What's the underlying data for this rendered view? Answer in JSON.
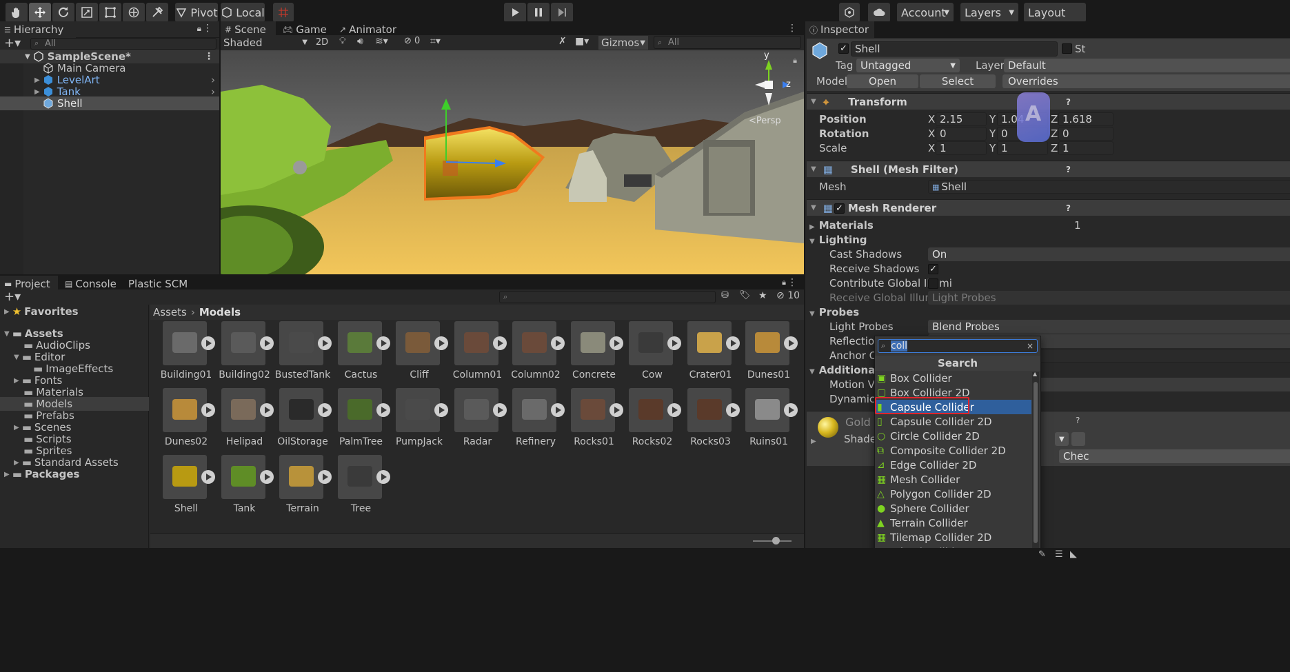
{
  "toolbar": {
    "pivot": "Pivot",
    "local": "Local",
    "account": "Account",
    "layers": "Layers",
    "layout": "Layout"
  },
  "hierarchy": {
    "tab": "Hierarchy",
    "search_placeholder": "All",
    "scene": "SampleScene*",
    "items": [
      "Main Camera",
      "LevelArt",
      "Tank",
      "Shell"
    ]
  },
  "scene_view": {
    "tabs": [
      "Scene",
      "Game",
      "Animator"
    ],
    "shading": "Shaded",
    "mode2d": "2D",
    "hidden_count": "0",
    "gizmos": "Gizmos",
    "search_placeholder": "All",
    "persp": "<Persp",
    "axis_y": "y",
    "axis_z": "z"
  },
  "project": {
    "tabs": [
      "Project",
      "Console",
      "Plastic SCM"
    ],
    "hidden_count": "10",
    "favorites": "Favorites",
    "assets_root": "Assets",
    "folders": [
      "AudioClips",
      "Editor",
      "ImageEffects",
      "Fonts",
      "Materials",
      "Models",
      "Prefabs",
      "Scenes",
      "Scripts",
      "Sprites",
      "Standard Assets"
    ],
    "packages": "Packages",
    "breadcrumb": [
      "Assets",
      "Models"
    ],
    "assets": [
      "Building01",
      "Building02",
      "BustedTank",
      "Cactus",
      "Cliff",
      "Column01",
      "Column02",
      "Concrete",
      "Cow",
      "Crater01",
      "Dunes01",
      "Dunes02",
      "Helipad",
      "OilStorage",
      "PalmTree",
      "PumpJack",
      "Radar",
      "Refinery",
      "Rocks01",
      "Rocks02",
      "Rocks03",
      "Ruins01",
      "Shell",
      "Tank",
      "Terrain",
      "Tree"
    ]
  },
  "inspector": {
    "tab": "Inspector",
    "object_name": "Shell",
    "static_partial": "St",
    "tag_label": "Tag",
    "tag_value": "Untagged",
    "layer_label": "Layer",
    "layer_value": "Default",
    "model_label": "Model",
    "open": "Open",
    "select": "Select",
    "overrides": "Overrides",
    "transform": {
      "title": "Transform",
      "position": "Position",
      "rotation": "Rotation",
      "scale": "Scale",
      "px": "2.15",
      "py": "1.04",
      "pz": "1.618",
      "rx": "0",
      "ry": "0",
      "rz": "0",
      "sx": "1",
      "sy": "1",
      "sz": "1",
      "x": "X",
      "y": "Y",
      "z": "Z"
    },
    "mesh_filter": {
      "title": "Shell (Mesh Filter)",
      "mesh_label": "Mesh",
      "mesh_value": "Shell"
    },
    "mesh_renderer": {
      "title": "Mesh Renderer",
      "materials": "Materials",
      "materials_count": "1",
      "lighting": "Lighting",
      "cast_shadows": "Cast Shadows",
      "cast_shadows_value": "On",
      "receive_shadows": "Receive Shadows",
      "contribute_gi": "Contribute Global Illumi",
      "receive_gi": "Receive Global Illumina",
      "receive_gi_value": "Light Probes",
      "probes": "Probes",
      "light_probes": "Light Probes",
      "light_probes_value": "Blend Probes",
      "reflection": "Reflection",
      "anchor": "Anchor Ov",
      "additional": "Additional Se",
      "motion": "Motion Ve",
      "dynamic": "Dynamic C"
    },
    "material": {
      "name": "Gold (",
      "shader": "Shader",
      "check_btn": "Chec"
    }
  },
  "add_component_popup": {
    "search_value": "coll",
    "title": "Search",
    "items": [
      "Box Collider",
      "Box Collider 2D",
      "Capsule Collider",
      "Capsule Collider 2D",
      "Circle Collider 2D",
      "Composite Collider 2D",
      "Edge Collider 2D",
      "Mesh Collider",
      "Polygon Collider 2D",
      "Sphere Collider",
      "Terrain Collider",
      "Tilemap Collider 2D",
      "Wheel Collider"
    ],
    "selected_index": 2
  },
  "colors": {
    "accent_blue": "#2f5f9c",
    "highlight_red": "#e0252c",
    "selected_row": "#4d4d4d"
  }
}
